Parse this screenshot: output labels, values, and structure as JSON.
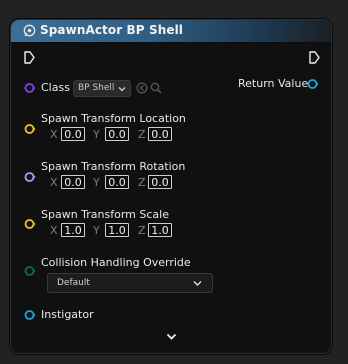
{
  "node": {
    "title": "SpawnActor BP Shell",
    "class_label": "Class",
    "class_value": "BP Shell",
    "return_label": "Return Value",
    "location": {
      "label": "Spawn Transform Location",
      "x": "0.0",
      "y": "0.0",
      "z": "0.0"
    },
    "rotation": {
      "label": "Spawn Transform Rotation",
      "x": "0.0",
      "y": "0.0",
      "z": "0.0"
    },
    "scale": {
      "label": "Spawn Transform Scale",
      "x": "1.0",
      "y": "1.0",
      "z": "1.0"
    },
    "axes": {
      "x": "X",
      "y": "Y",
      "z": "Z"
    },
    "collision": {
      "label": "Collision Handling Override",
      "value": "Default"
    },
    "instigator_label": "Instigator"
  },
  "colors": {
    "class_pin": "#8a3cff",
    "vector_pin": "#f0c31f",
    "rotator_pin": "#9aa6ff",
    "object_pin": "#1aa7e6",
    "enum_pin": "#0b6b65",
    "header_accent": "#3b6f97"
  },
  "icons": {
    "title": "function-icon",
    "exec_in": "exec-in-pin-icon",
    "exec_out": "exec-out-pin-icon",
    "use": "use-selected-asset-icon",
    "browse": "browse-asset-icon",
    "expand": "chevron-down-icon"
  }
}
